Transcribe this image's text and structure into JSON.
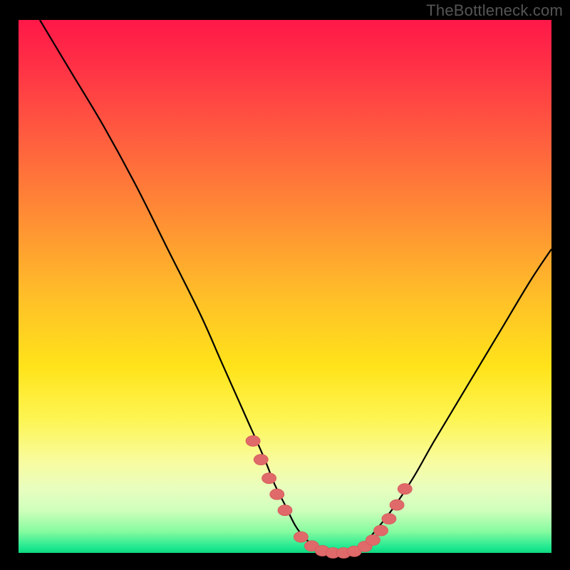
{
  "watermark": "TheBottleneck.com",
  "colors": {
    "marker": "#e06a6a",
    "marker_stroke": "#d45858",
    "curve": "#000000",
    "gradient_top": "#ff1848",
    "gradient_bottom": "#0fd87f"
  },
  "chart_data": {
    "type": "line",
    "title": "",
    "xlabel": "",
    "ylabel": "",
    "xlim": [
      0,
      100
    ],
    "ylim": [
      0,
      100
    ],
    "grid": false,
    "legend": false,
    "series": [
      {
        "name": "curve",
        "x": [
          4,
          10,
          16,
          22,
          28,
          34,
          38,
          42,
          46,
          48,
          50,
          52,
          54,
          56,
          58,
          60,
          62,
          64,
          66,
          70,
          74,
          78,
          84,
          90,
          96,
          100
        ],
        "y": [
          100,
          90,
          80,
          69,
          57,
          45,
          36,
          27,
          18,
          13,
          9,
          5,
          2.5,
          1,
          0.3,
          0,
          0.3,
          1,
          3,
          8,
          14,
          21,
          31,
          41,
          51,
          57
        ]
      }
    ],
    "markers": {
      "name": "highlight-points",
      "x": [
        44,
        45.5,
        47,
        48.5,
        50,
        53,
        55,
        57,
        59,
        61,
        63,
        65,
        66.5,
        68,
        69.5,
        71,
        72.5
      ],
      "y": [
        21,
        17.5,
        14,
        11,
        8,
        3,
        1.3,
        0.4,
        0,
        0,
        0.3,
        1.2,
        2.4,
        4.2,
        6.4,
        9,
        12
      ]
    }
  }
}
